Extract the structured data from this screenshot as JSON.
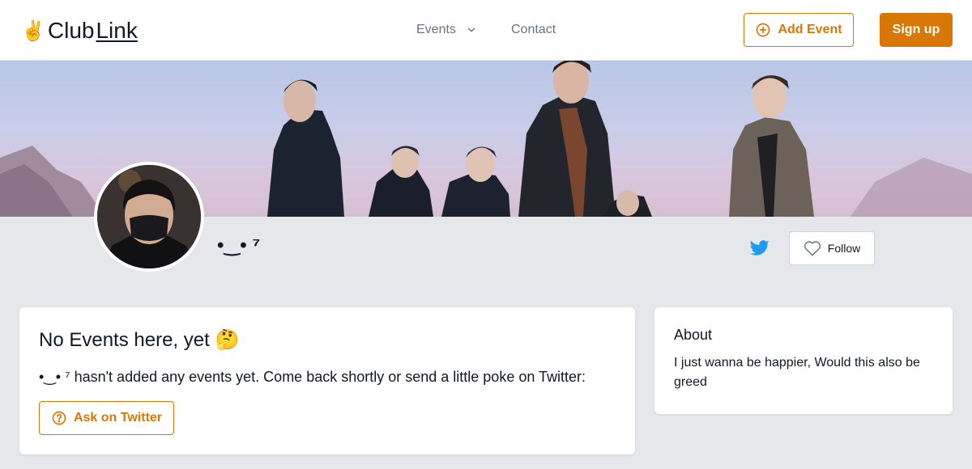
{
  "header": {
    "logo_icon": "✌️",
    "logo_club": "Club",
    "logo_link": "Link",
    "nav_events": "Events",
    "nav_contact": "Contact",
    "add_event_label": "Add Event",
    "signup_label": "Sign up"
  },
  "profile": {
    "name": "•‿• ⁷",
    "follow_label": "Follow",
    "twitter_icon": "twitter-icon"
  },
  "events_card": {
    "title": "No Events here, yet 🤔",
    "message": "•‿• ⁷ hasn't added any events yet. Come back shortly or send a little poke on Twitter:",
    "ask_button": "Ask on Twitter"
  },
  "about_card": {
    "title": "About",
    "text": "I just wanna be happier, Would this also be greed"
  },
  "colors": {
    "accent": "#d97706",
    "twitter": "#1d9bf0",
    "background": "#e5e7eb"
  }
}
